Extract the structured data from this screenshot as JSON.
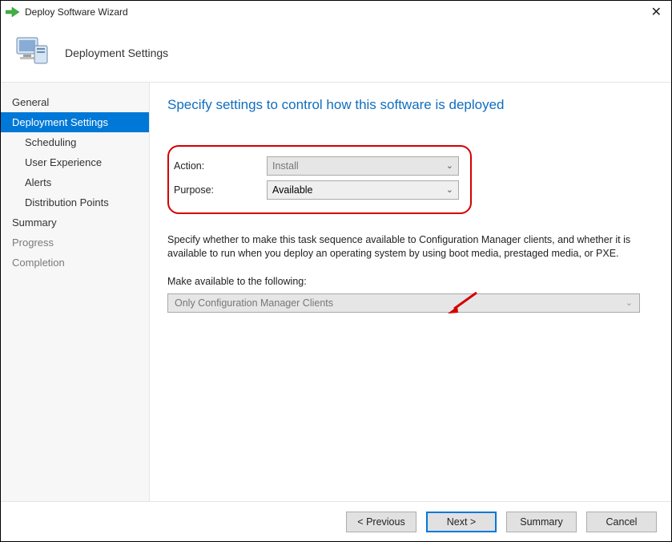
{
  "window": {
    "title": "Deploy Software Wizard"
  },
  "header": {
    "subtitle": "Deployment Settings"
  },
  "sidebar": {
    "items": [
      {
        "label": "General"
      },
      {
        "label": "Deployment Settings"
      },
      {
        "label": "Scheduling"
      },
      {
        "label": "User Experience"
      },
      {
        "label": "Alerts"
      },
      {
        "label": "Distribution Points"
      },
      {
        "label": "Summary"
      },
      {
        "label": "Progress"
      },
      {
        "label": "Completion"
      }
    ]
  },
  "main": {
    "heading": "Specify settings to control how this software is deployed",
    "fields": {
      "action_label": "Action:",
      "action_value": "Install",
      "purpose_label": "Purpose:",
      "purpose_value": "Available"
    },
    "info_text": "Specify whether to make this task sequence available to Configuration Manager clients, and whether it is available to run when you deploy an operating system by using boot media, prestaged media, or PXE.",
    "make_available_label": "Make available to the following:",
    "make_available_value": "Only Configuration Manager Clients"
  },
  "footer": {
    "previous": "< Previous",
    "next": "Next >",
    "summary": "Summary",
    "cancel": "Cancel"
  }
}
